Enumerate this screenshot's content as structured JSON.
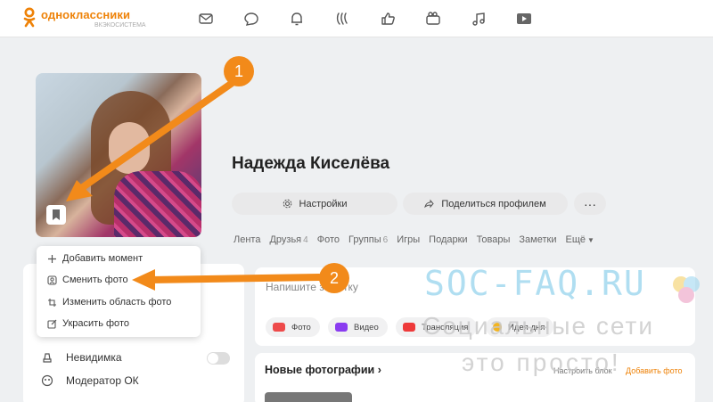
{
  "brand": {
    "title": "одноклассники",
    "subtitle": "ВКЭКОСИСТЕМА",
    "accent": "#ee8208"
  },
  "nav_icons": [
    "mail-icon",
    "chat-icon",
    "bell-icon",
    "guests-icon",
    "like-icon",
    "video-camera-icon",
    "music-icon",
    "video-play-icon"
  ],
  "profile": {
    "name": "Надежда Киселёва",
    "settings_label": "Настройки",
    "share_label": "Поделиться профилем",
    "more_label": "···"
  },
  "tabs": [
    {
      "label": "Лента",
      "count": ""
    },
    {
      "label": "Друзья",
      "count": "4"
    },
    {
      "label": "Фото",
      "count": ""
    },
    {
      "label": "Группы",
      "count": "6"
    },
    {
      "label": "Игры",
      "count": ""
    },
    {
      "label": "Подарки",
      "count": ""
    },
    {
      "label": "Товары",
      "count": ""
    },
    {
      "label": "Заметки",
      "count": ""
    },
    {
      "label": "Ещё",
      "count": ""
    }
  ],
  "avatar_menu": {
    "add_moment": "Добавить момент",
    "change_photo": "Сменить фото",
    "change_area": "Изменить область фото",
    "decorate": "Украсить фото"
  },
  "left_menu": {
    "invisible": "Невидимка",
    "moderator": "Модератор ОК"
  },
  "post": {
    "placeholder": "Напишите заметку",
    "chips": [
      {
        "label": "Фото",
        "color": "#ee4a4a"
      },
      {
        "label": "Видео",
        "color": "#8a3cf0"
      },
      {
        "label": "Трансляция",
        "color": "#ee3a3a"
      },
      {
        "label": "Идея дня",
        "color": "#f2b420"
      }
    ]
  },
  "photos": {
    "title": "Новые фотографии",
    "setup": "Настроить блок",
    "add": "Добавить фото"
  },
  "annotations": {
    "step1": "1",
    "step2": "2",
    "arrow_color": "#f28a1a"
  },
  "watermark": {
    "site": "SOC-FAQ.RU",
    "line1": "Социальные сети",
    "line2": "это просто!"
  }
}
